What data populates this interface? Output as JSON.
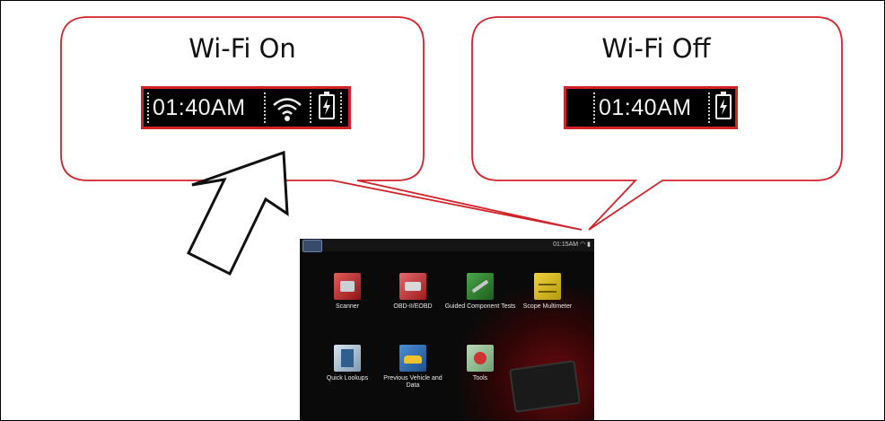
{
  "callouts": {
    "wifi_on": {
      "title": "Wi-Fi On",
      "time": "01:40AM",
      "icons": [
        "wifi-icon",
        "battery-icon"
      ]
    },
    "wifi_off": {
      "title": "Wi-Fi Off",
      "time": "01:40AM",
      "icons": [
        "battery-icon"
      ]
    }
  },
  "device_screen": {
    "status_time": "01:15AM",
    "apps_row1": [
      {
        "label": "Scanner",
        "icon": "scanner-icon"
      },
      {
        "label": "OBD-II/EOBD",
        "icon": "obd-icon"
      },
      {
        "label": "Guided Component Tests",
        "icon": "guided-tests-icon"
      },
      {
        "label": "Scope Multimeter",
        "icon": "scope-icon"
      }
    ],
    "apps_row2": [
      {
        "label": "Quick Lookups",
        "icon": "lookups-icon"
      },
      {
        "label": "Previous Vehicle and Data",
        "icon": "vehicle-icon"
      },
      {
        "label": "Tools",
        "icon": "tools-icon"
      }
    ]
  },
  "colors": {
    "callout_border": "#d2232a",
    "statusbar_bg": "#000000",
    "screen_bg": "#0a0a0a"
  }
}
